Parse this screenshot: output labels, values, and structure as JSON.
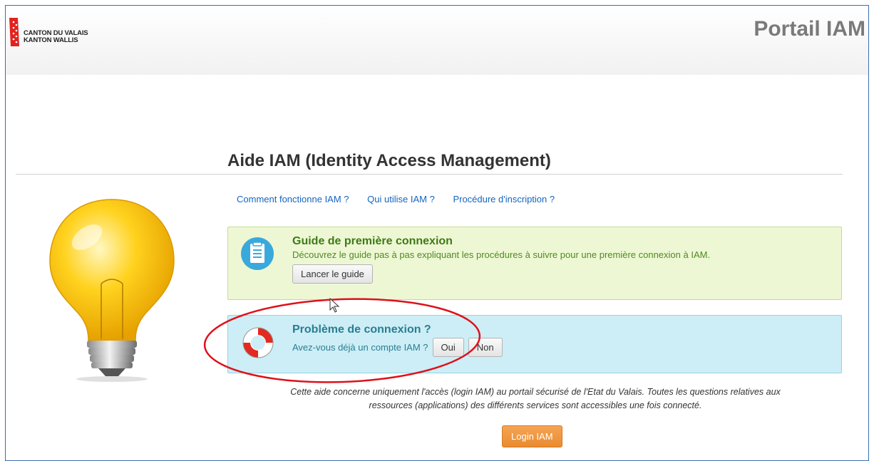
{
  "header": {
    "logo_line1": "CANTON DU VALAIS",
    "logo_line2": "KANTON WALLIS",
    "portal_title": "Portail IAM"
  },
  "page_title": "Aide IAM (Identity Access Management)",
  "links": [
    "Comment fonctionne IAM ?",
    "Qui utilise IAM ?",
    "Procédure d'inscription ?"
  ],
  "guide_box": {
    "title": "Guide de première connexion",
    "description": "Découvrez le guide pas à pas expliquant les procédures à suivre pour une première connexion à IAM.",
    "button": "Lancer le guide",
    "icon": "document-icon"
  },
  "problem_box": {
    "title": "Problème de connexion ?",
    "question": "Avez-vous déjà un compte IAM ?",
    "yes": "Oui",
    "no": "Non",
    "icon": "lifebuoy-icon"
  },
  "footer_note_line1": "Cette aide concerne uniquement l'accès (login IAM) au portail sécurisé de l'Etat du Valais. Toutes les questions relatives aux",
  "footer_note_line2": "ressources (applications) des différents services sont accessibles une fois connecté.",
  "login_button": "Login IAM",
  "colors": {
    "accent_link": "#1565c0",
    "login_orange": "#ec8f34",
    "annotation_red": "#e0101a"
  }
}
